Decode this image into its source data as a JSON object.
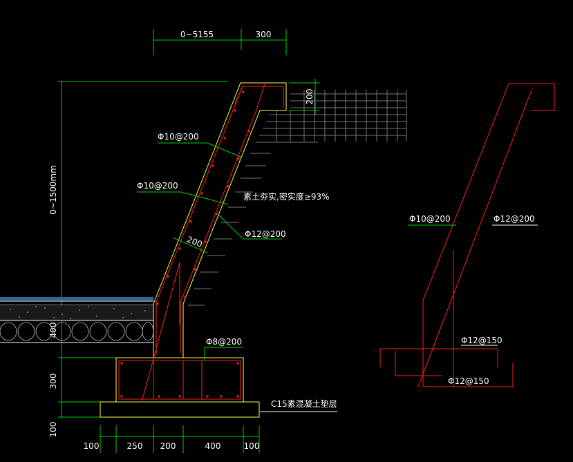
{
  "top_dims": [
    "0~5155",
    "300"
  ],
  "left_dims": [
    "0~1500mm",
    "400",
    "300",
    "100"
  ],
  "bottom_dims": [
    "100",
    "250",
    "200",
    "400",
    "100"
  ],
  "cap_dim": "200",
  "thickness_dim": "200",
  "labels": {
    "rebar_top": "Φ10@200",
    "rebar_mid": "Φ10@200",
    "rebar_inner": "Φ12@200",
    "rebar_base": "Φ8@200",
    "backfill": "素土夯实,密实度≥93%",
    "cushion": "C15素混凝土垫层"
  },
  "detail_labels": {
    "left": "Φ10@200",
    "right": "Φ12@200",
    "top_bar": "Φ12@150",
    "bottom_bar": "Φ12@150"
  },
  "colors": {
    "background": "#000000",
    "dimension": "#00d000",
    "rebar": "#ff2020",
    "concrete": "#ffff40",
    "text": "#ffffff"
  }
}
